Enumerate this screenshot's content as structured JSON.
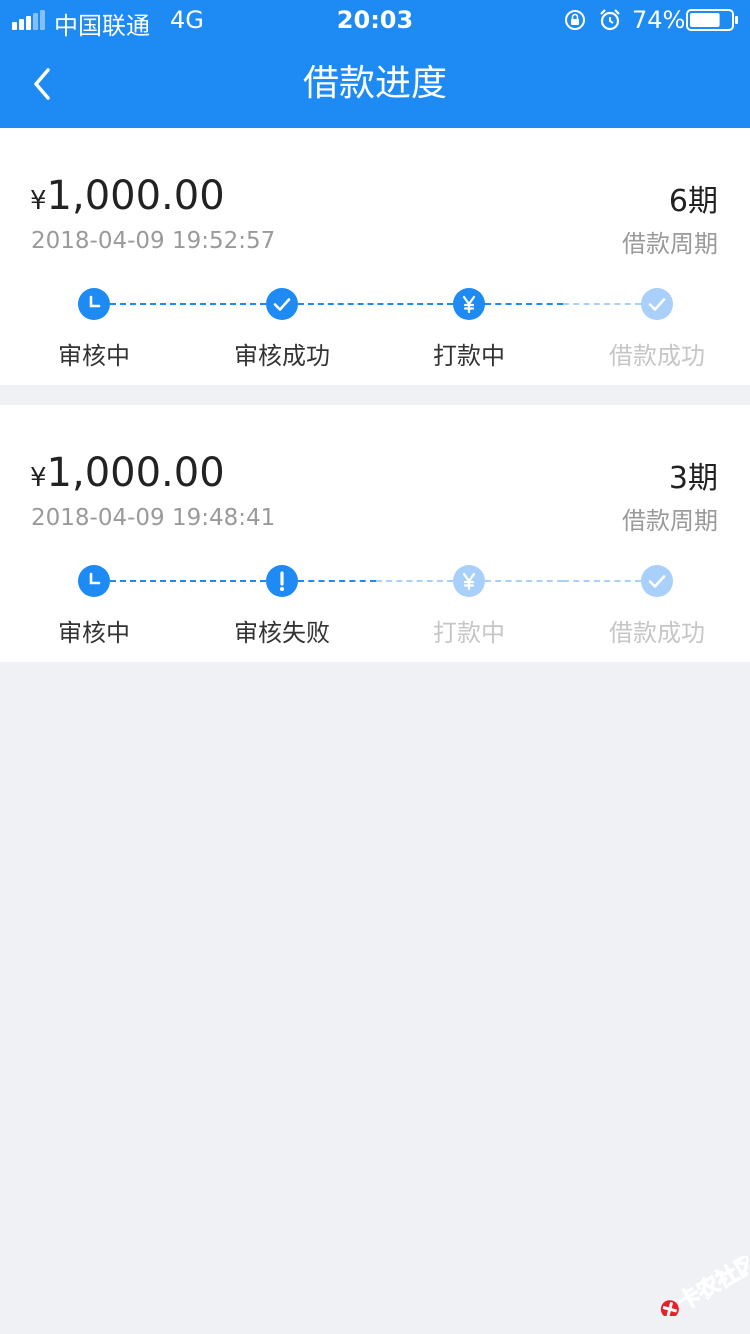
{
  "status_bar": {
    "carrier": "中国联通",
    "network": "4G",
    "time": "20:03",
    "battery_percent": "74%",
    "battery_level": 0.74,
    "icons": [
      "signal-icon",
      "orientation-lock-icon",
      "alarm-icon",
      "battery-icon"
    ]
  },
  "nav": {
    "title": "借款进度",
    "back_icon": "chevron-left-icon"
  },
  "colors": {
    "primary": "#1e8af3",
    "primary_light": "#a8d0fa",
    "text_dark": "#222222",
    "text_gray": "#9a9a9a",
    "text_light": "#c6c6c6",
    "background": "#eff1f5"
  },
  "loans": [
    {
      "currency": "¥",
      "amount": "1,000.00",
      "datetime": "2018-04-09 19:52:57",
      "period": "6期",
      "period_label": "借款周期",
      "steps": [
        {
          "label": "审核中",
          "icon": "clock-icon",
          "active": true
        },
        {
          "label": "审核成功",
          "icon": "check-icon",
          "active": true
        },
        {
          "label": "打款中",
          "icon": "yen-icon",
          "active": true
        },
        {
          "label": "借款成功",
          "icon": "check-icon",
          "active": false
        }
      ]
    },
    {
      "currency": "¥",
      "amount": "1,000.00",
      "datetime": "2018-04-09 19:48:41",
      "period": "3期",
      "period_label": "借款周期",
      "steps": [
        {
          "label": "审核中",
          "icon": "clock-icon",
          "active": true
        },
        {
          "label": "审核失败",
          "icon": "exclamation-icon",
          "active": true
        },
        {
          "label": "打款中",
          "icon": "yen-icon",
          "active": false
        },
        {
          "label": "借款成功",
          "icon": "check-icon",
          "active": false
        }
      ]
    }
  ],
  "watermark": {
    "text": "卡农社区",
    "icon": "watermark-logo-icon"
  }
}
